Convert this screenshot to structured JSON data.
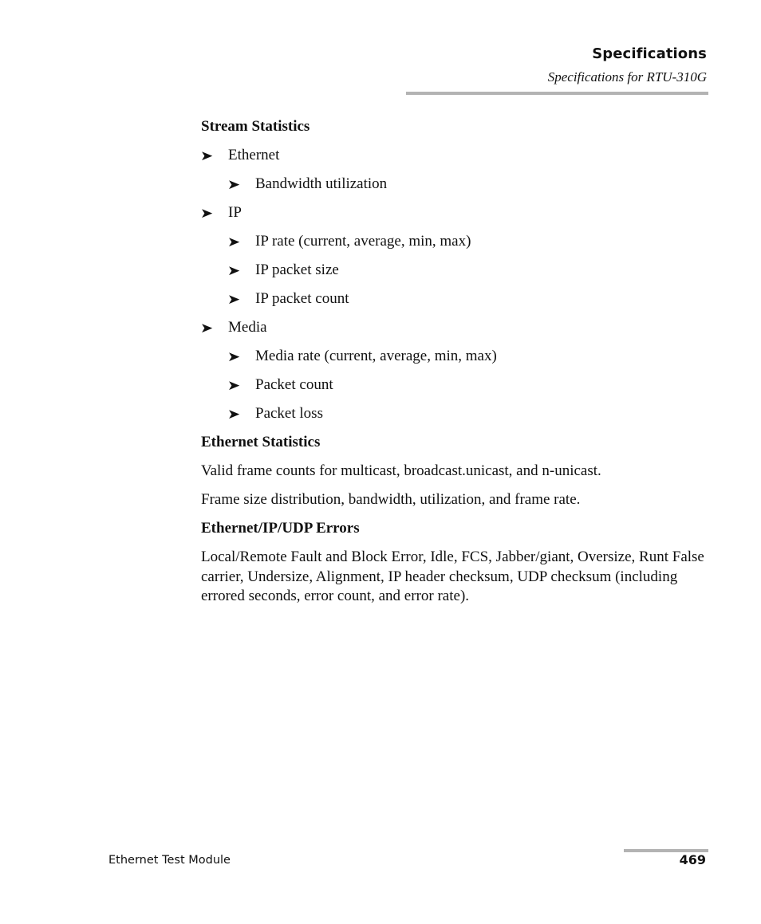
{
  "header": {
    "chapter": "Specifications",
    "section": "Specifications for RTU-310G"
  },
  "stream_statistics": {
    "heading": "Stream Statistics",
    "items": [
      {
        "label": "Ethernet",
        "children": [
          "Bandwidth utilization"
        ]
      },
      {
        "label": "IP",
        "children": [
          "IP rate (current, average, min, max)",
          "IP packet size",
          "IP packet count"
        ]
      },
      {
        "label": "Media",
        "children": [
          "Media rate (current, average, min, max)",
          "Packet count",
          "Packet loss"
        ]
      }
    ]
  },
  "ethernet_statistics": {
    "heading": "Ethernet Statistics",
    "paragraphs": [
      "Valid frame counts for multicast, broadcast.unicast, and n-unicast.",
      "Frame size distribution, bandwidth, utilization, and frame rate."
    ]
  },
  "errors": {
    "heading": "Ethernet/IP/UDP Errors",
    "paragraph": "Local/Remote Fault and Block Error, Idle, FCS, Jabber/giant, Oversize, Runt False carrier, Undersize, Alignment, IP header checksum, UDP checksum (including errored seconds, error count, and error rate)."
  },
  "bullet_glyph": "➤",
  "footer": {
    "manual_title": "Ethernet Test Module",
    "page_number": "469"
  }
}
